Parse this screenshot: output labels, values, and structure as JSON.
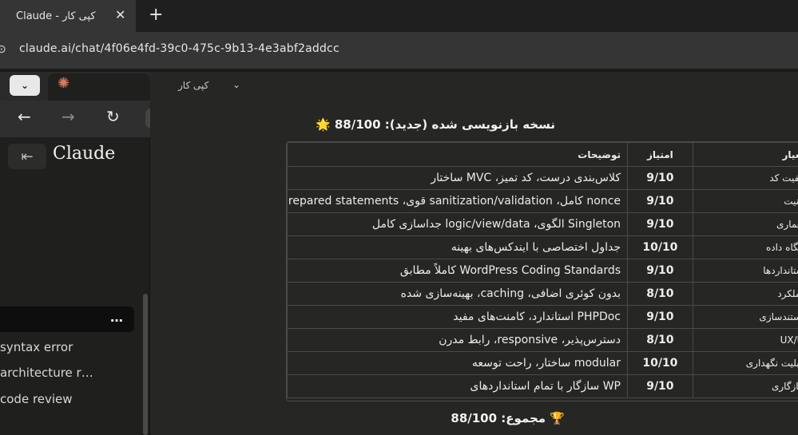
{
  "browser": {
    "tab_title": "Claude - کپی کار",
    "tab_close": "✕",
    "new_tab": "+",
    "url": "claude.ai/chat/4f06e4fd-39c0-475c-9b13-4e3abf2addcc"
  },
  "inner_browser": {
    "dropdown": "⌄",
    "back": "←",
    "forward": "→",
    "reload": "↻"
  },
  "sidebar": {
    "brand": "Claude",
    "collapse_icon": "⇤",
    "more": "…",
    "chats": [
      "syntax error",
      "architecture r…",
      "code review"
    ]
  },
  "main": {
    "chat_title": "کپی کار",
    "chevron": "⌄",
    "heading": "نسخه بازنویسی شده (جدید): 88/100 🌟",
    "table": {
      "headers": [
        "معیار",
        "امتیاز",
        "توضیحات"
      ],
      "rows": [
        [
          "کیفیت کد",
          "9/10",
          "کلاس‌بندی درست، کد تمیز، MVC ساختار"
        ],
        [
          "امنیت",
          "9/10",
          "nonce کامل، sanitization/validation قوی، prepared statements"
        ],
        [
          "معماری",
          "9/10",
          "Singleton الگوی، logic/view/data جداسازی کامل"
        ],
        [
          "پایگاه داده",
          "10/10",
          "جداول اختصاصی با ایندکس‌های بهینه"
        ],
        [
          "استانداردها",
          "9/10",
          "WordPress Coding Standards کاملاً مطابق"
        ],
        [
          "عملکرد",
          "8/10",
          "بدون کوئری اضافی، caching، بهینه‌سازی شده"
        ],
        [
          "مستندسازی",
          "9/10",
          "PHPDoc استاندارد، کامنت‌های مفید"
        ],
        [
          "UX/UI",
          "8/10",
          "دسترس‌پذیر، responsive، رابط مدرن"
        ],
        [
          "قابلیت نگهداری",
          "10/10",
          "modular ساختار، راحت توسعه"
        ],
        [
          "سازگاری",
          "9/10",
          "WP سازگار با تمام استانداردهای"
        ]
      ]
    },
    "total": "🏆 مجموع: 88/100"
  }
}
